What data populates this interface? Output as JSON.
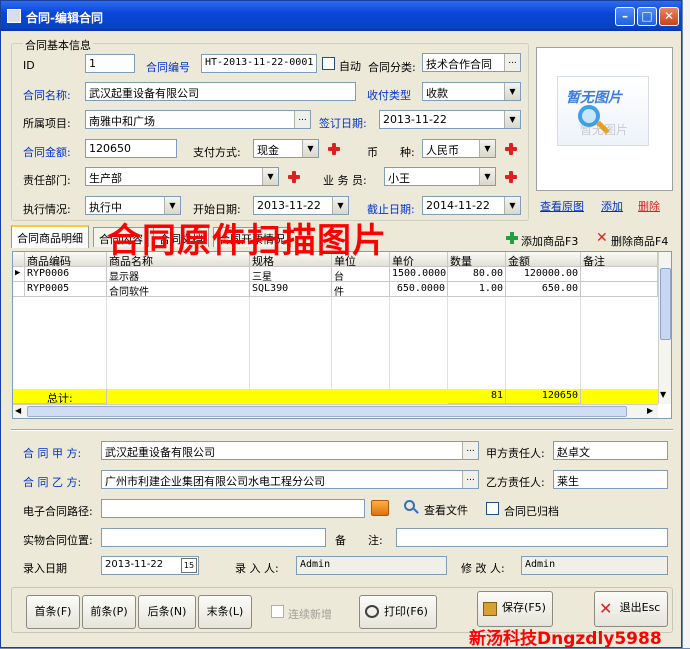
{
  "window": {
    "title": "合同-编辑合同"
  },
  "basic_info": {
    "group_label": "合同基本信息",
    "id_label": "ID",
    "id_value": "1",
    "contract_no_label": "合同编号",
    "contract_no_value": "HT-2013-11-22-0001",
    "auto_label": "自动",
    "category_label": "合同分类:",
    "category_value": "技术合作合同",
    "name_label": "合同名称:",
    "name_value": "武汉起重设备有限公司",
    "pay_type_label": "收付类型",
    "pay_type_value": "收款",
    "project_label": "所属项目:",
    "project_value": "南雅中和广场",
    "sign_date_label": "签订日期:",
    "sign_date_value": "2013-11-22",
    "amount_label": "合同金额:",
    "amount_value": "120650",
    "pay_method_label": "支付方式:",
    "pay_method_value": "现金",
    "currency_label": "币　　种:",
    "currency_value": "人民币",
    "dept_label": "责任部门:",
    "dept_value": "生产部",
    "salesman_label": "业 务 员:",
    "salesman_value": "小王",
    "exec_label": "执行情况:",
    "exec_value": "执行中",
    "start_date_label": "开始日期:",
    "start_date_value": "2013-11-22",
    "end_date_label": "截止日期:",
    "end_date_value": "2014-11-22"
  },
  "image_panel": {
    "no_image_text": "暂无图片",
    "no_image_ghost": "暂无图片",
    "view_label": "查看原图",
    "add_label": "添加",
    "delete_label": "删除"
  },
  "overlay_title": "合同原件扫描图片",
  "tabs": [
    {
      "label": "合同商品明细"
    },
    {
      "label": "合同内容"
    },
    {
      "label": "合同文档"
    },
    {
      "label": "合同开票情况"
    }
  ],
  "grid_actions": {
    "add_label": "添加商品F3",
    "remove_label": "删除商品F4"
  },
  "grid": {
    "columns": [
      "商品编码",
      "商品名称",
      "规格",
      "单位",
      "单价",
      "数量",
      "金额",
      "备注"
    ],
    "rows": [
      {
        "code": "RYP0006",
        "name": "显示器",
        "spec": "三星",
        "unit": "台",
        "price": "1500.0000",
        "qty": "80.00",
        "amount": "120000.00",
        "note": ""
      },
      {
        "code": "RYP0005",
        "name": "合同软件",
        "spec": "SQL390",
        "unit": "件",
        "price": "650.0000",
        "qty": "1.00",
        "amount": "650.00",
        "note": ""
      }
    ],
    "total_label": "总计:",
    "total_qty": "81",
    "total_amount": "120650"
  },
  "parties": {
    "party_a_label": "合 同 甲 方:",
    "party_a_value": "武汉起重设备有限公司",
    "party_a_person_label": "甲方责任人:",
    "party_a_person_value": "赵卓文",
    "party_b_label": "合 同 乙 方:",
    "party_b_value": "广州市利建企业集团有限公司水电工程分公司",
    "party_b_person_label": "乙方责任人:",
    "party_b_person_value": "莱生",
    "epath_label": "电子合同路径:",
    "epath_value": "",
    "view_file_label": "查看文件",
    "archived_label": "合同已归档",
    "physical_label": "实物合同位置:",
    "physical_value": "",
    "remark_label": "备　　注:",
    "remark_value": "",
    "entry_date_label": "录入日期",
    "entry_date_value": "2013-11-22",
    "cal_label": "15",
    "entry_person_label": "录 入 人:",
    "entry_person_value": "Admin",
    "modifier_label": "修 改 人:",
    "modifier_value": "Admin"
  },
  "footer": {
    "first_label": "首条(F)",
    "prev_label": "前条(P)",
    "next_label": "后条(N)",
    "last_label": "末条(L)",
    "continuous_label": "连续新增",
    "print_label": "打印(F6)",
    "save_label": "保存(F5)",
    "exit_label": "退出Esc"
  },
  "watermark": "新汤科技Dngzdly5988",
  "colors": {
    "accent_blue": "#0033cc",
    "total_row": "#ffff00",
    "overlay_red": "#ff0000"
  }
}
